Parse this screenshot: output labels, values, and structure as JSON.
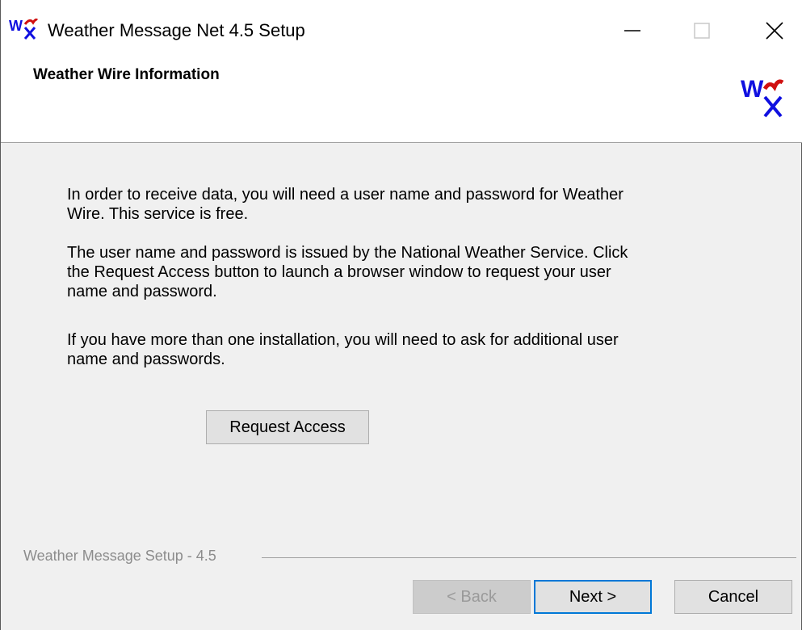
{
  "window": {
    "title": "Weather Message Net 4.5 Setup",
    "icon": "weather-message-logo-icon"
  },
  "header": {
    "title": "Weather Wire Information",
    "logo": "weather-message-logo-icon"
  },
  "body": {
    "paragraphs": [
      "In order to receive data, you will need a user name and password for Weather Wire.  This service is free.",
      "The user name and password is issued by the National Weather Service.  Click the Request Access button to launch a browser window to request your user name and password.",
      "If you have more than one installation, you will need to ask for additional user name and passwords."
    ],
    "request_access_label": "Request Access"
  },
  "footer": {
    "group_label": "Weather Message Setup - 4.5",
    "back_label": "< Back",
    "next_label": "Next >",
    "cancel_label": "Cancel"
  },
  "colors": {
    "logo_blue": "#1010e0",
    "logo_red": "#d01010",
    "focus_border": "#0078d7"
  }
}
